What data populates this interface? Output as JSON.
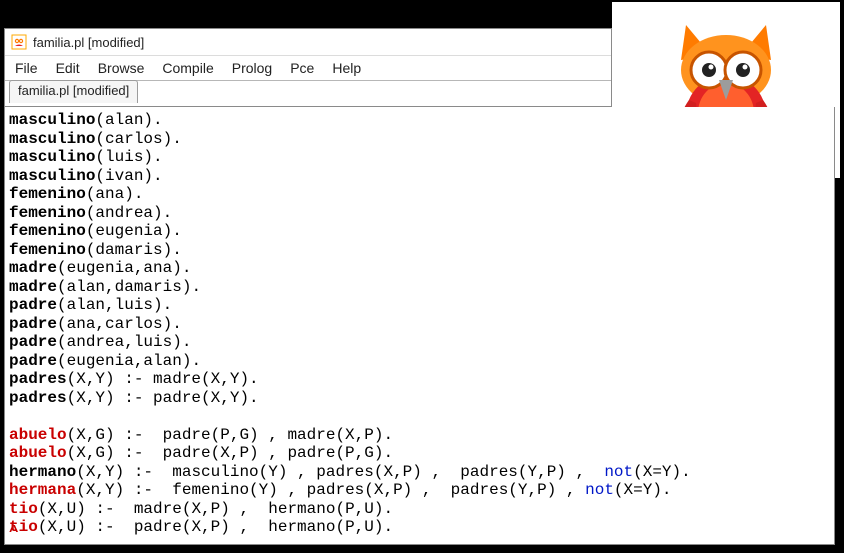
{
  "window": {
    "title": "familia.pl [modified]"
  },
  "menu": {
    "file": "File",
    "edit": "Edit",
    "browse": "Browse",
    "compile": "Compile",
    "prolog": "Prolog",
    "pce": "Pce",
    "help": "Help"
  },
  "tab": {
    "label": "familia.pl [modified]"
  },
  "pred": {
    "masculino": "masculino",
    "femenino": "femenino",
    "madre": "madre",
    "padre": "padre",
    "padres": "padres",
    "abuelo": "abuelo",
    "hermano": "hermano",
    "hermana": "hermana",
    "tio": "tio"
  },
  "expr": {
    "l1": "(alan).",
    "l2": "(carlos).",
    "l3": "(luis).",
    "l4": "(ivan).",
    "l5": "(ana).",
    "l6": "(andrea).",
    "l7": "(eugenia).",
    "l8": "(damaris).",
    "l9": "(eugenia,ana).",
    "l10": "(alan,damaris).",
    "l11": "(alan,luis).",
    "l12": "(ana,carlos).",
    "l13": "(andrea,luis).",
    "l14": "(eugenia,alan).",
    "l15": "(X,Y) :- madre(X,Y).",
    "l16": "(X,Y) :- padre(X,Y).",
    "l17": "(X,G) :-  padre(P,G) , madre(X,P).",
    "l18": "(X,G) :-  padre(X,P) , padre(P,G).",
    "l19a": "(X,Y) :-  masculino(Y) , padres(X,P) ,  padres(Y,P) ,  ",
    "l19b": "(X=Y).",
    "l20a": "(X,Y) :-  femenino(Y) , padres(X,P) ,  padres(Y,P) , ",
    "l20b": "(X=Y).",
    "l21": "(X,U) :-  madre(X,P) ,  hermano(P,U).",
    "l22": "(X,U) :-  padre(X,P) ,  hermano(P,U)."
  },
  "kw": {
    "not": "not"
  },
  "icons": {
    "app": "app-icon",
    "owl": "owl-logo"
  }
}
